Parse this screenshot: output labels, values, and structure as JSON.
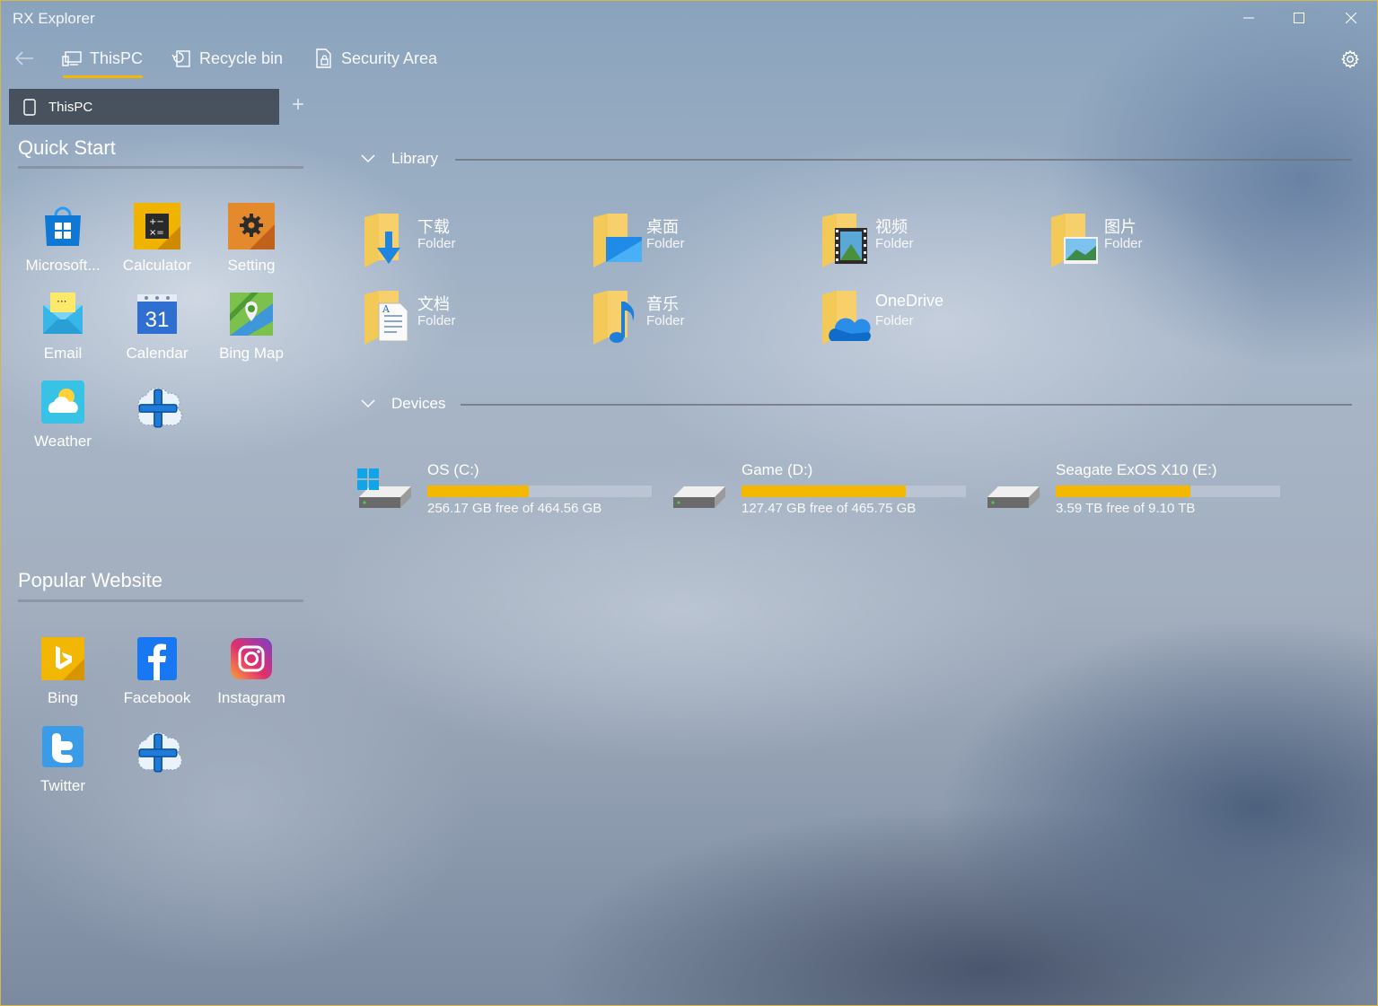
{
  "window": {
    "title": "RX Explorer"
  },
  "nav": {
    "thispc": "ThisPC",
    "recycle": "Recycle bin",
    "security": "Security Area"
  },
  "tabs": [
    {
      "label": "ThisPC"
    }
  ],
  "quick_start": {
    "title": "Quick Start",
    "items": [
      {
        "label": "Microsoft...",
        "icon": "microsoft-store-icon"
      },
      {
        "label": "Calculator",
        "icon": "calculator-icon"
      },
      {
        "label": "Setting",
        "icon": "setting-icon"
      },
      {
        "label": "Email",
        "icon": "email-icon"
      },
      {
        "label": "Calendar",
        "icon": "calendar-icon",
        "badge": "31"
      },
      {
        "label": "Bing Map",
        "icon": "bing-map-icon"
      },
      {
        "label": "Weather",
        "icon": "weather-icon"
      }
    ]
  },
  "popular_website": {
    "title": "Popular Website",
    "items": [
      {
        "label": "Bing",
        "icon": "bing-icon"
      },
      {
        "label": "Facebook",
        "icon": "facebook-icon"
      },
      {
        "label": "Instagram",
        "icon": "instagram-icon"
      },
      {
        "label": "Twitter",
        "icon": "twitter-icon"
      }
    ]
  },
  "library": {
    "title": "Library",
    "folders": [
      {
        "name": "下载",
        "type": "Folder",
        "icon": "downloads-folder-icon"
      },
      {
        "name": "桌面",
        "type": "Folder",
        "icon": "desktop-folder-icon"
      },
      {
        "name": "视频",
        "type": "Folder",
        "icon": "videos-folder-icon"
      },
      {
        "name": "图片",
        "type": "Folder",
        "icon": "pictures-folder-icon"
      },
      {
        "name": "文档",
        "type": "Folder",
        "icon": "documents-folder-icon"
      },
      {
        "name": "音乐",
        "type": "Folder",
        "icon": "music-folder-icon"
      },
      {
        "name": "OneDrive",
        "type": "Folder",
        "icon": "onedrive-folder-icon"
      }
    ]
  },
  "devices": {
    "title": "Devices",
    "drives": [
      {
        "name": "OS (C:)",
        "free_text": "256.17 GB free of 464.56 GB",
        "used_fraction": 0.45,
        "icon": "system-drive-icon"
      },
      {
        "name": "Game (D:)",
        "free_text": "127.47 GB free of 465.75 GB",
        "used_fraction": 0.73,
        "icon": "hard-drive-icon"
      },
      {
        "name": "Seagate ExOS X10 (E:)",
        "free_text": "3.59 TB free of 9.10 TB",
        "used_fraction": 0.6,
        "icon": "hard-drive-icon"
      }
    ]
  },
  "colors": {
    "accent": "#f5b800",
    "tab_bg": "#373e48",
    "frame": "#d8b54a"
  }
}
